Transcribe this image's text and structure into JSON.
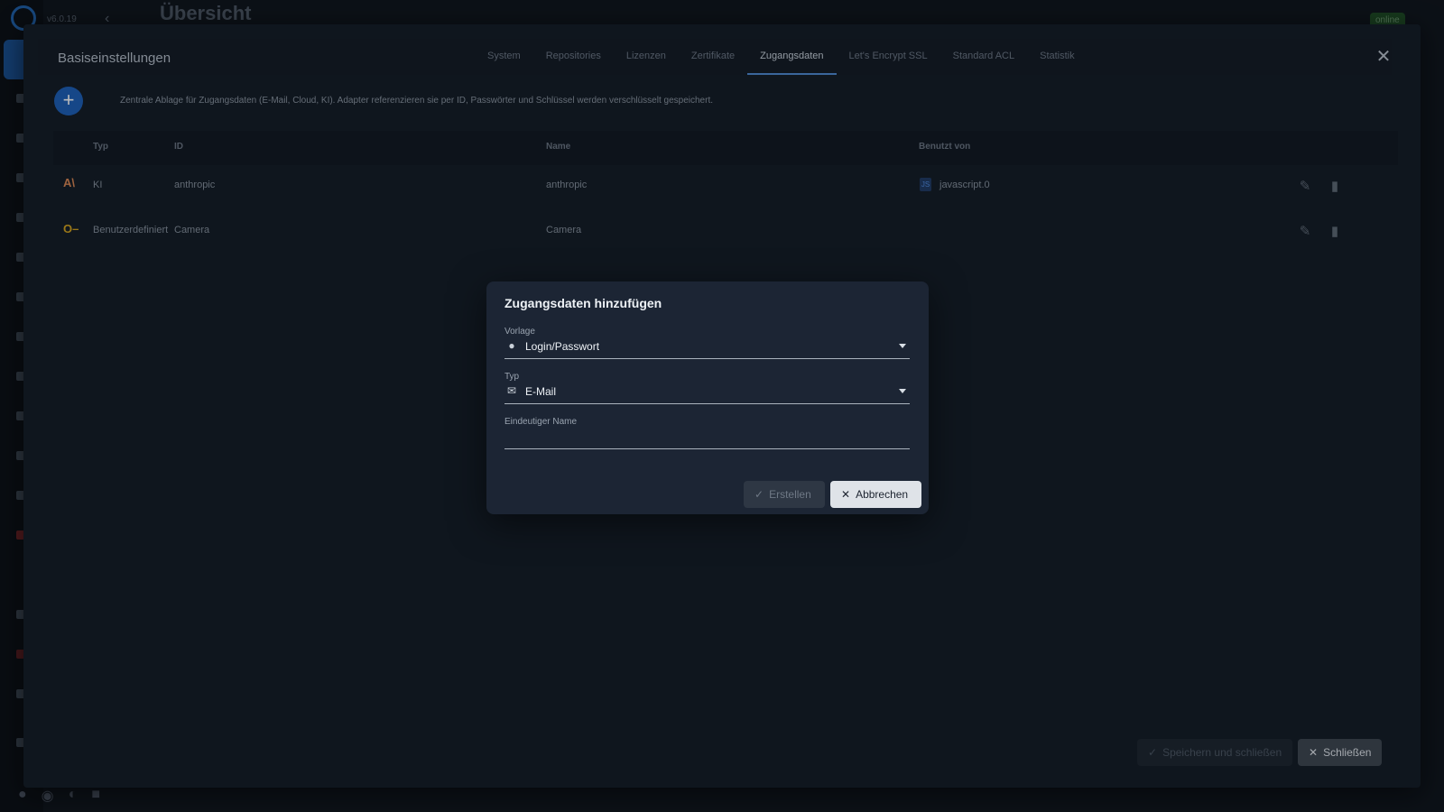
{
  "app": {
    "version": "v6.0.19",
    "page_title": "Übersicht",
    "status_badge": "online"
  },
  "settings": {
    "title": "Basiseinstellungen",
    "tabs": [
      {
        "label": "System"
      },
      {
        "label": "Repositories"
      },
      {
        "label": "Lizenzen"
      },
      {
        "label": "Zertifikate"
      },
      {
        "label": "Zugangsdaten",
        "active": true
      },
      {
        "label": "Let's Encrypt SSL"
      },
      {
        "label": "Standard ACL"
      },
      {
        "label": "Statistik"
      }
    ],
    "info_text": "Zentrale Ablage für Zugangsdaten (E-Mail, Cloud, KI). Adapter referenzieren sie per ID, Passwörter und Schlüssel werden verschlüsselt gespeichert.",
    "table": {
      "headers": {
        "type": "Typ",
        "id": "ID",
        "name": "Name",
        "used_by": "Benutzt von"
      },
      "rows": [
        {
          "icon": "anthropic-icon",
          "type": "KI",
          "id": "anthropic",
          "name": "anthropic",
          "used_by": "javascript.0",
          "used_by_badge": "JS"
        },
        {
          "icon": "key-icon",
          "type": "Benutzerdefiniert",
          "id": "Camera",
          "name": "Camera",
          "used_by": ""
        }
      ]
    },
    "footer": {
      "save_close_label": "Speichern und schließen",
      "close_label": "Schließen"
    }
  },
  "dialog": {
    "title": "Zugangsdaten hinzufügen",
    "template_label": "Vorlage",
    "template_value": "Login/Passwort",
    "type_label": "Typ",
    "type_value": "E-Mail",
    "name_label": "Eindeutiger Name",
    "name_value": "",
    "create_label": "Erstellen",
    "cancel_label": "Abbrechen"
  },
  "colors": {
    "accent": "#1d5fb8",
    "tab_indicator": "#4e8ad2",
    "dialog_bg": "#1c2534",
    "anthropic_icon": "#d98552",
    "key_icon": "#d4a21c"
  }
}
